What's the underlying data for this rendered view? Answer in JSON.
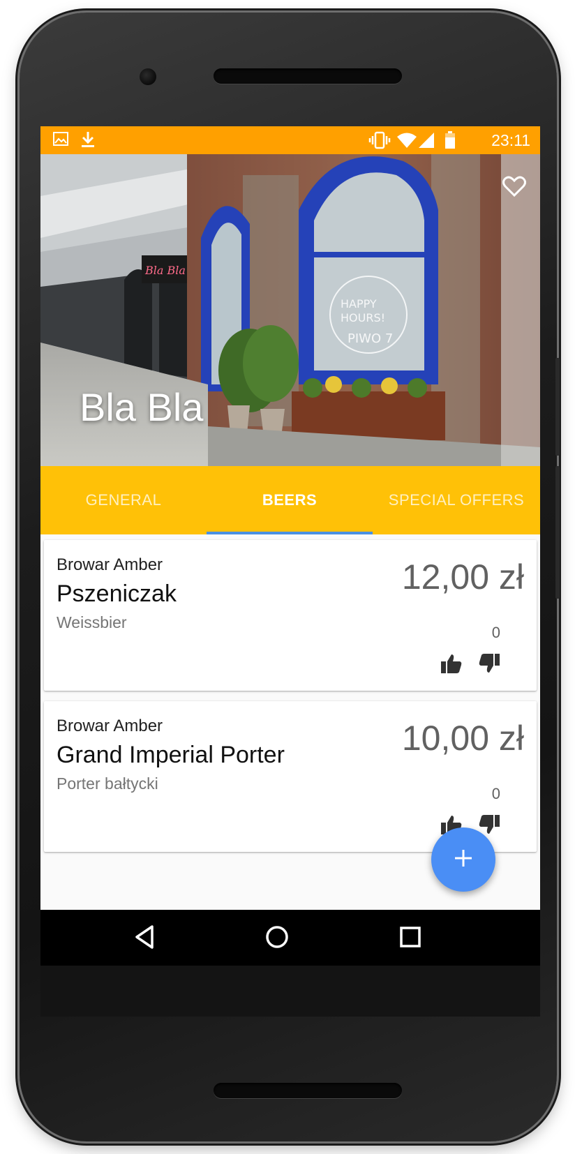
{
  "status_bar": {
    "time": "23:11",
    "left_icons": [
      "image-icon",
      "download-icon"
    ],
    "right_icons": [
      "vibrate-icon",
      "wifi-icon",
      "signal-icon",
      "battery-icon"
    ],
    "color": "#FFA000"
  },
  "header": {
    "title": "Bla Bla",
    "favorite_icon": "heart-outline-icon"
  },
  "tabs": [
    {
      "label": "GENERAL",
      "active": false
    },
    {
      "label": "BEERS",
      "active": true
    },
    {
      "label": "SPECIAL OFFERS",
      "active": false
    }
  ],
  "tab_color": "#FFC107",
  "indicator_color": "#4A90E2",
  "beers": [
    {
      "brewery": "Browar Amber",
      "name": "Pszeniczak",
      "style": "Weissbier",
      "price": "12,00 zł",
      "votes": "0"
    },
    {
      "brewery": "Browar Amber",
      "name": "Grand Imperial Porter",
      "style": "Porter bałtycki",
      "price": "10,00 zł",
      "votes": "0"
    }
  ],
  "fab": {
    "icon": "plus-icon",
    "color": "#4A8EF5"
  },
  "nav_bar": {
    "icons": [
      "back-icon",
      "home-icon",
      "recents-icon"
    ]
  }
}
